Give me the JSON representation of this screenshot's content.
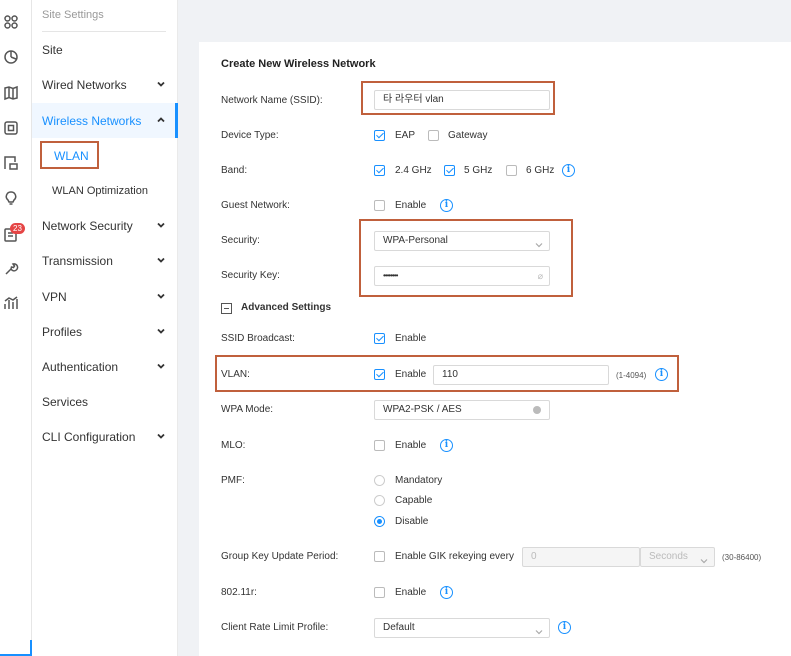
{
  "rail": {
    "icons": [
      "apps-icon",
      "clock-icon",
      "map-icon",
      "device-icon",
      "switch-icon",
      "bulb-icon",
      "messages-icon",
      "wrench-icon",
      "stats-icon"
    ],
    "badge": "23"
  },
  "menu": {
    "top_label": "Site Settings",
    "items": [
      {
        "label": "Site"
      },
      {
        "label": "Wired Networks"
      },
      {
        "label": "Wireless Networks"
      },
      {
        "label": "WLAN"
      },
      {
        "label": "WLAN Optimization"
      },
      {
        "label": "Network Security"
      },
      {
        "label": "Transmission"
      },
      {
        "label": "VPN"
      },
      {
        "label": "Profiles"
      },
      {
        "label": "Authentication"
      },
      {
        "label": "Services"
      },
      {
        "label": "CLI Configuration"
      }
    ]
  },
  "colors": {
    "accent": "#1890ff",
    "highlight": "#c0603c"
  },
  "form": {
    "title": "Create New Wireless Network",
    "ssid": {
      "label": "Network Name (SSID):",
      "value": "타 라우터 vlan"
    },
    "device_type": {
      "label": "Device Type:",
      "eap": "EAP",
      "gateway": "Gateway"
    },
    "band": {
      "label": "Band:",
      "b24": "2.4 GHz",
      "b5": "5 GHz",
      "b6": "6 GHz"
    },
    "guest": {
      "label": "Guest Network:",
      "enable": "Enable"
    },
    "security": {
      "label": "Security:",
      "value": "WPA-Personal"
    },
    "security_key": {
      "label": "Security Key:",
      "value": "••••••••"
    },
    "advanced": "Advanced Settings",
    "ssid_broadcast": {
      "label": "SSID Broadcast:",
      "enable": "Enable"
    },
    "vlan": {
      "label": "VLAN:",
      "enable": "Enable",
      "value": "110",
      "range": "(1-4094)"
    },
    "wpa_mode": {
      "label": "WPA Mode:",
      "value": "WPA2-PSK / AES"
    },
    "mlo": {
      "label": "MLO:",
      "enable": "Enable"
    },
    "pmf": {
      "label": "PMF:",
      "mandatory": "Mandatory",
      "capable": "Capable",
      "disable": "Disable"
    },
    "gik": {
      "label": "Group Key Update Period:",
      "enable": "Enable GIK rekeying every",
      "value": "0",
      "unit": "Seconds",
      "range": "(30-86400)"
    },
    "r80211": {
      "label": "802.11r:",
      "enable": "Enable"
    },
    "rate_limit": {
      "label": "Client Rate Limit Profile:",
      "value": "Default"
    }
  }
}
